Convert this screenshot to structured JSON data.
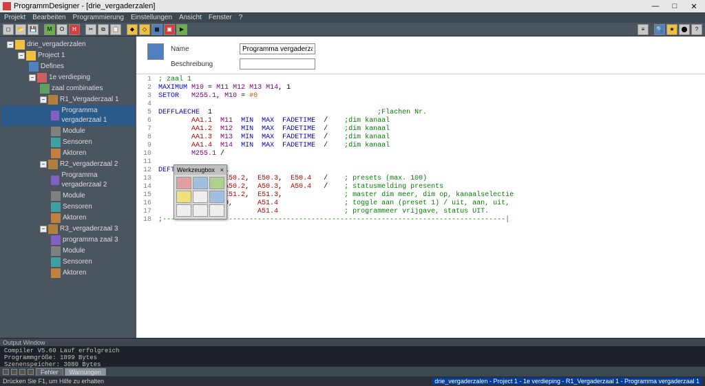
{
  "title": "ProgrammDesigner - [drie_vergaderzalen]",
  "menu": [
    "Projekt",
    "Bearbeiten",
    "Programmierung",
    "Einstellungen",
    "Ansicht",
    "Fenster",
    "?"
  ],
  "window_buttons": {
    "min": "—",
    "max": "□",
    "close": "✕"
  },
  "tree": {
    "root": "drie_vergaderzalen",
    "project": "Project 1",
    "defines": "Defines",
    "floor": "1e verdieping",
    "zaal_comb": "zaal combinaties",
    "rooms": [
      {
        "name": "R1_Vergaderzaal 1",
        "prog": "Programma vergaderzaal 1",
        "mod": "Module",
        "sen": "Sensoren",
        "akt": "Aktoren"
      },
      {
        "name": "R2_vergaderzaal 2",
        "prog": "Programma vergaderzaal 2",
        "mod": "Module",
        "sen": "Sensoren",
        "akt": "Aktoren"
      },
      {
        "name": "R3_vergaderzaal 3",
        "prog": "programma zaal 3",
        "mod": "Module",
        "sen": "Sensoren",
        "akt": "Aktoren"
      }
    ]
  },
  "form": {
    "name_label": "Name",
    "name_value": "Programma vergaderzaal 1",
    "desc_label": "Beschreibung",
    "desc_value": ""
  },
  "code_lines": [
    "; zaal 1",
    "MAXIMUM M10 = M11 M12 M13 M14, 1",
    "SETOR   M255.1, M10 = #0",
    "",
    "DEFFLAECHE  1                                        ;Flachen Nr.",
    "        AA1.1  M11  MIN  MAX  FADETIME  /    ;dim kanaal",
    "        AA1.2  M12  MIN  MAX  FADETIME  /    ;dim kanaal",
    "        AA1.3  M13  MIN  MAX  FADETIME  /    ;dim kanaal",
    "        AA1.4  M14  MIN  MAX  FADETIME  /    ;dim kanaal",
    "        M255.1 /",
    "",
    "DEFTABLD    1,  1",
    "        E50.1,  E50.2,  E50.3,  E50.4   /    ; presets (max. 100)",
    "        A50.1,  A50.2,  A50.3,  A50.4   /    ; statusmelding presents",
    "        E51.1,  E51.2,  E51.3,               ; master dim meer, dim op, kanaalselectie",
    "        0,      0,      A51.4                ; toggle aan (preset 1) / uit, aan, uit,",
    "        1,              A51.4                ; programmeer vrijgave, status UIT.",
    ";-----------------------------------------------------------------------------------|"
  ],
  "toolbox_title": "Werkzeugbox",
  "output_title": "Output Window",
  "output": [
    "Compiler V5.60 Lauf erfolgreich",
    "Programmgröße: 1899 Bytes",
    "Szenenspeicher: 3080 Bytes"
  ],
  "tabs": [
    "Fehler",
    "Warnungen"
  ],
  "status_left": "Drücken Sie F1, um Hilfe zu erhalten",
  "breadcrumb": "drie_vergaderzalen - Project 1 - 1e verdieping - R1_Vergaderzaal 1 - Programma vergaderzaal 1"
}
